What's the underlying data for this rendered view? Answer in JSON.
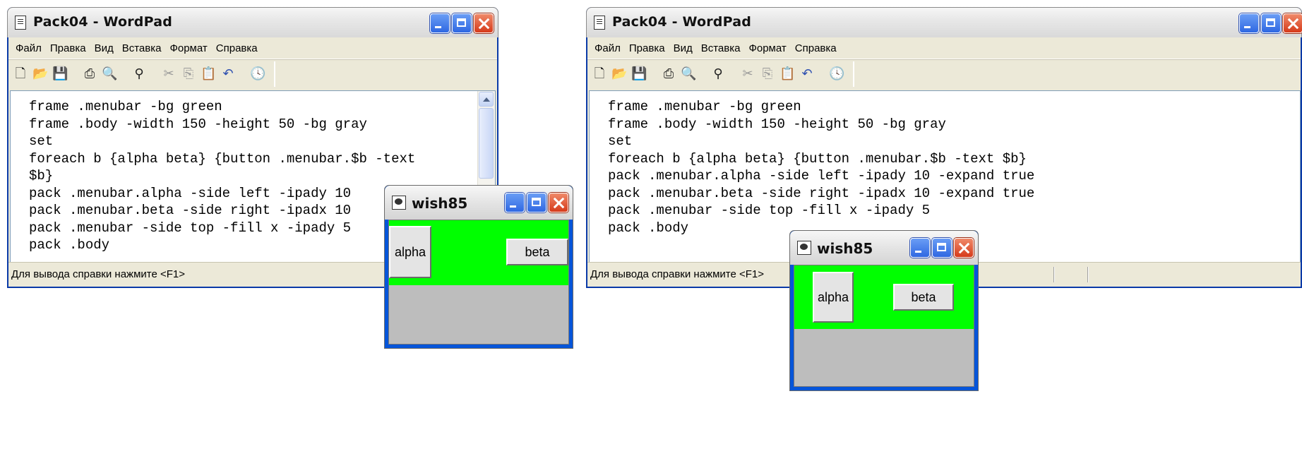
{
  "wordpad": {
    "title": "Pack04 - WordPad",
    "menu": [
      "Файл",
      "Правка",
      "Вид",
      "Вставка",
      "Формат",
      "Справка"
    ],
    "status": "Для вывода справки нажмите <F1>",
    "toolbar_icons": [
      "new-document-icon",
      "open-icon",
      "save-icon",
      "print-icon",
      "print-preview-icon",
      "find-icon",
      "cut-icon",
      "copy-icon",
      "paste-icon",
      "undo-icon",
      "date-time-icon"
    ]
  },
  "left_code": [
    "frame .menubar -bg green",
    "frame .body -width 150 -height 50 -bg gray",
    "set",
    "foreach b {alpha beta} {button .menubar.$b -text",
    "$b}",
    "pack .menubar.alpha -side left -ipady 10",
    "pack .menubar.beta -side right -ipadx 10",
    "pack .menubar -side top -fill x -ipady 5",
    "pack .body"
  ],
  "right_code": [
    "frame .menubar -bg green",
    "frame .body -width 150 -height 50 -bg gray",
    "set",
    "foreach b {alpha beta} {button .menubar.$b -text $b}",
    "pack .menubar.alpha -side left -ipady 10 -expand true",
    "pack .menubar.beta -side right -ipadx 10 -expand true",
    "pack .menubar -side top -fill x -ipady 5",
    "pack .body"
  ],
  "wish": {
    "title": "wish85",
    "buttons": [
      "alpha",
      "beta"
    ],
    "colors": {
      "menubar": "#00ff00",
      "body": "#bdbdbd"
    }
  }
}
